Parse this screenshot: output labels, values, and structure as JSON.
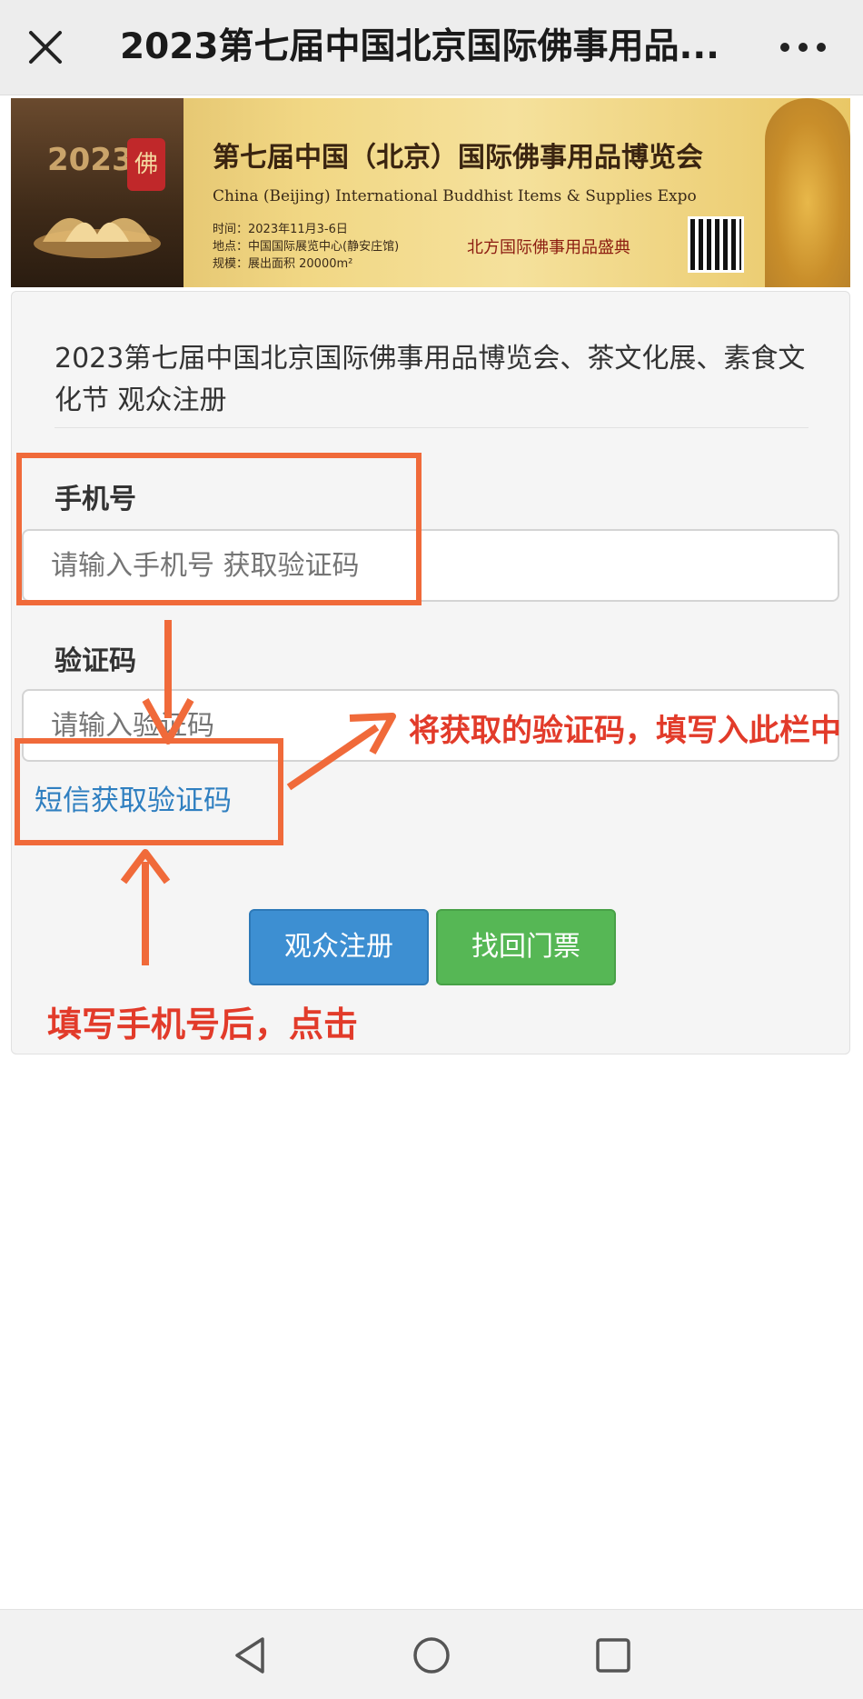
{
  "topbar": {
    "title": "2023第七届中国北京国际佛事用品...",
    "close_icon": "close-icon",
    "more_icon": "more-dots-icon"
  },
  "banner": {
    "year": "2023",
    "seal_char": "佛",
    "title": "第七届中国（北京）国际佛事用品博览会",
    "english_title": "China (Beijing) International Buddhist Items & Supplies Expo",
    "time": "时间：2023年11月3-6日",
    "venue": "地点：中国国际展览中心(静安庄馆)",
    "scale": "规模：展出面积 20000m²",
    "brand": "北方国际佛事用品盛典"
  },
  "form": {
    "title": "2023第七届中国北京国际佛事用品博览会、茶文化展、素食文化节 观众注册",
    "phone_label": "手机号",
    "phone_placeholder": "请输入手机号 获取验证码",
    "code_label": "验证码",
    "code_placeholder": "请输入验证码",
    "sms_link": "短信获取验证码",
    "register_button": "观众注册",
    "retrieve_button": "找回门票"
  },
  "annotations": {
    "enter_code_hint": "将获取的验证码，填写入此栏中",
    "click_hint": "填写手机号后，点击"
  },
  "colors": {
    "annotation_orange": "#f06a3a",
    "annotation_text_red": "#e23b2a",
    "primary_blue": "#3d8fd2",
    "success_green": "#56b755",
    "link_blue": "#2f7fc0"
  },
  "navbar": {
    "icons": [
      "back-triangle-icon",
      "home-circle-icon",
      "recents-square-icon"
    ]
  }
}
